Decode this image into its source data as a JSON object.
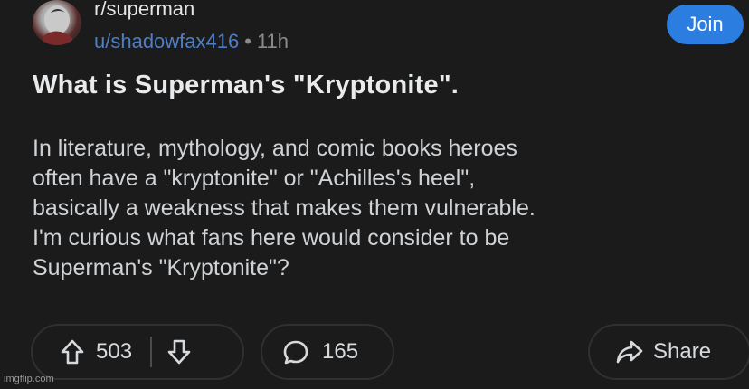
{
  "header": {
    "subreddit": "r/superman",
    "username": "u/shadowfax416",
    "separator": "•",
    "time_ago": "11h",
    "join_label": "Join"
  },
  "post": {
    "title": "What is Superman's \"Kryptonite\".",
    "body_lines": [
      "In literature, mythology, and comic books heroes",
      "often have a \"kryptonite\" or \"Achilles's heel\",",
      "basically a weakness that makes them vulnerable.",
      "I'm curious what fans here would consider to be",
      "Superman's \"Kryptonite\"?"
    ]
  },
  "actions": {
    "upvote_icon": "arrow-up-outline-icon",
    "vote_count": "503",
    "downvote_icon": "arrow-down-outline-icon",
    "comment_icon": "speech-bubble-icon",
    "comment_count": "165",
    "share_icon": "share-arrow-icon",
    "share_label": "Share"
  },
  "watermark": "imgflip.com",
  "colors": {
    "background": "#1b1b1c",
    "join_button": "#2b7de0",
    "username": "#4f7ec2",
    "muted": "#8a8d90"
  }
}
